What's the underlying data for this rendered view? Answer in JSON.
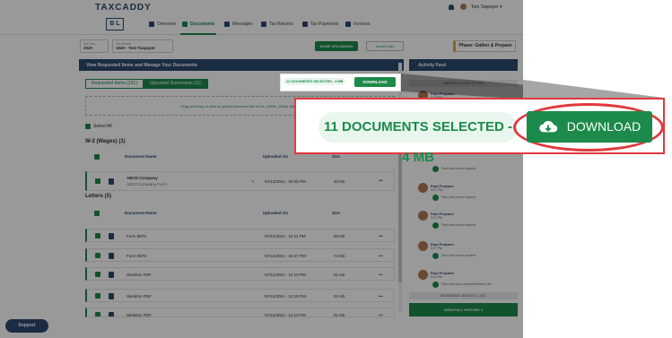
{
  "app": {
    "logo": "TAXCADDY",
    "brand_mark": "B L",
    "user_name": "Tom Taxpayer ▾"
  },
  "nav": {
    "items": [
      {
        "label": "Overview"
      },
      {
        "label": "Documents"
      },
      {
        "label": "Messages"
      },
      {
        "label": "Tax Returns"
      },
      {
        "label": "Tax Payments"
      },
      {
        "label": "Invoices"
      }
    ]
  },
  "toolbar": {
    "tax_year_caption": "Tax Year",
    "tax_year": "2020",
    "return_caption": "Tax Return",
    "return_value": "1040 - Tom Taxpayer",
    "done_uploading": "DONE UPLOADING",
    "smart_links": "Smart Links",
    "phase": "Phase: Gather & Prepare"
  },
  "panel": {
    "title": "View Requested Items and Manage Your Documents",
    "tab_requested": "Requested Items (231)",
    "tab_uploaded": "Uploaded Documents (11)",
    "dropzone": "Drag and drop or click to upload document like W-2s, 1099s, 1098s, bills...",
    "select_all": "Select All",
    "section_w2": "W-2 (Wages)  (1)",
    "section_letters": "Letters  (5)",
    "col_name": "Document Name",
    "col_uploaded": "Uploaded On",
    "col_size": "Size",
    "w2_rows": [
      {
        "name": "ABCD Company",
        "sub": "ABCD Company Form",
        "date": "07/13/2021 - 03:45 PM",
        "size": "40 KB"
      }
    ],
    "letter_rows": [
      {
        "name": "Form 8879",
        "date": "07/12/2021 - 12:11 PM",
        "size": "89 KB"
      },
      {
        "name": "Form 8879",
        "date": "07/12/2021 - 02:47 PM",
        "size": "74 KB"
      },
      {
        "name": "Skeleton PDF",
        "date": "07/12/2021 - 12:10 PM",
        "size": "51 KB"
      },
      {
        "name": "Skeleton PDF",
        "date": "07/12/2021 - 12:10 PM",
        "size": "51 KB"
      },
      {
        "name": "Skeleton PDF",
        "date": "07/12/2021 - 12:10 PM",
        "size": "51 KB"
      }
    ],
    "more": "•••"
  },
  "activity": {
    "title": "Activity Feed",
    "date_1": "TUESDAY, AUGUST 10, 2021",
    "date_2": "WEDNESDAY, AUGUST 4, 2021",
    "items": [
      {
        "name": "Paul Preparer",
        "time": "3:32 PM",
        "text": "Paul sent a new request."
      },
      {
        "name": "Paul Preparer",
        "time": "3:27 PM",
        "text": "Paul sent a new request."
      },
      {
        "name": "Paul Preparer",
        "time": "3:27 PM",
        "text": "Paul sent a new request."
      },
      {
        "name": "Paul Preparer",
        "time": "3:27 PM",
        "text": "Paul sent a new request."
      },
      {
        "name": "Paul Preparer",
        "time": "3:22 PM",
        "text": "Paul sent you a requested items list."
      }
    ],
    "footer": "VIEW FULL HISTORY  >"
  },
  "mini": {
    "selected": "11 DOCUMENTS SELECTED - 4 MB",
    "download": "DOWNLOAD"
  },
  "zoom": {
    "selected": "11 DOCUMENTS SELECTED - 4 MB",
    "download": "DOWNLOAD"
  },
  "support": "Support",
  "colors": {
    "green": "#1b8a4a",
    "navy": "#2c4a6e",
    "highlight_red": "#e03a3e"
  }
}
